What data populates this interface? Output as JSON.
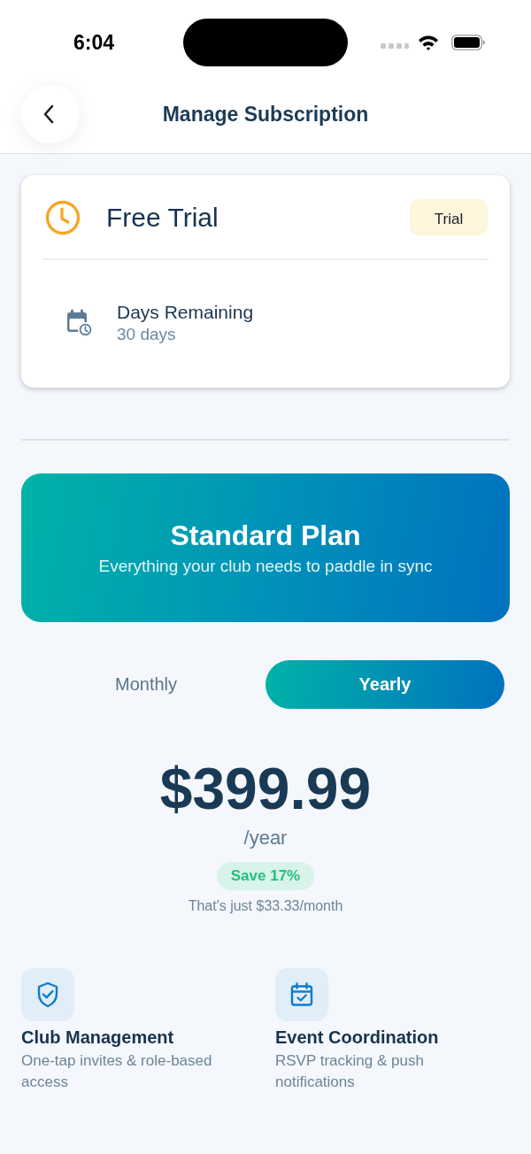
{
  "status_bar": {
    "time": "6:04"
  },
  "header": {
    "title": "Manage Subscription"
  },
  "trial_card": {
    "title": "Free Trial",
    "badge": "Trial",
    "detail": {
      "label": "Days Remaining",
      "value": "30 days"
    }
  },
  "plan": {
    "name": "Standard Plan",
    "tagline": "Everything your club needs to paddle in sync"
  },
  "billing_toggle": [
    {
      "label": "Monthly",
      "selected": false
    },
    {
      "label": "Yearly",
      "selected": true
    }
  ],
  "price": {
    "amount": "$399.99",
    "period": "/year",
    "savings": "Save 17%",
    "note": "That's just $33.33/month"
  },
  "features": [
    {
      "title": "Club Management",
      "description": "One-tap invites & role-based access"
    },
    {
      "title": "Event Coordination",
      "description": "RSVP tracking & push notifications"
    }
  ]
}
